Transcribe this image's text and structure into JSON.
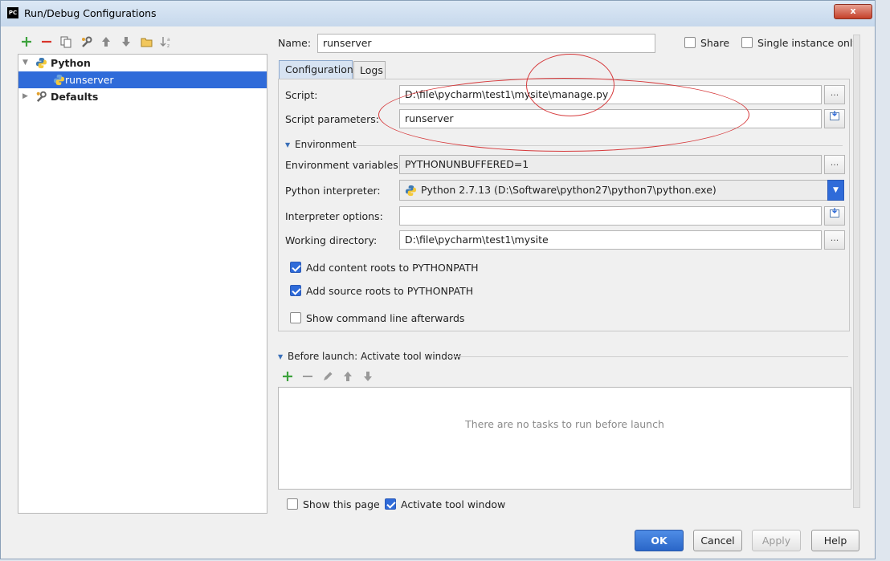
{
  "window": {
    "title": "Run/Debug Configurations",
    "app_icon_text": "PC",
    "close_glyph": "x"
  },
  "toolbar_icons": [
    "add-icon",
    "remove-icon",
    "copy-icon",
    "wrench-icon",
    "move-up-icon",
    "move-down-icon",
    "folder-icon",
    "sort-az-icon"
  ],
  "tree": {
    "items": [
      {
        "label": "Python",
        "bold": true,
        "expanded": true
      },
      {
        "label": "runserver",
        "selected": true
      },
      {
        "label": "Defaults",
        "bold": true,
        "expanded": false
      }
    ]
  },
  "name_row": {
    "label": "Name:",
    "value": "runserver",
    "share_label": "Share",
    "single_instance_label": "Single instance only"
  },
  "tabs": [
    {
      "label": "Configuration",
      "active": true
    },
    {
      "label": "Logs",
      "active": false
    }
  ],
  "config": {
    "script_label": "Script:",
    "script_value": "D:\\file\\pycharm\\test1\\mysite\\manage.py",
    "script_params_label": "Script parameters:",
    "script_params_value": "runserver",
    "environment_section": "Environment",
    "env_vars_label": "Environment variables:",
    "env_vars_value": "PYTHONUNBUFFERED=1",
    "interpreter_label": "Python interpreter:",
    "interpreter_value": "Python 2.7.13 (D:\\Software\\python27\\python7\\python.exe)",
    "interp_options_label": "Interpreter options:",
    "interp_options_value": "",
    "working_dir_label": "Working directory:",
    "working_dir_value": "D:\\file\\pycharm\\test1\\mysite",
    "add_content_roots": "Add content roots to PYTHONPATH",
    "add_source_roots": "Add source roots to PYTHONPATH",
    "show_cmd_line": "Show command line afterwards",
    "browse_glyph": "..."
  },
  "before_launch": {
    "title": "Before launch: Activate tool window",
    "empty_text": "There are no tasks to run before launch",
    "show_page_label": "Show this page",
    "activate_tool_window_label": "Activate tool window"
  },
  "buttons": {
    "ok": "OK",
    "cancel": "Cancel",
    "apply": "Apply",
    "help": "Help"
  },
  "colors": {
    "selection": "#2f6bd9",
    "annotation": "#d6393b"
  }
}
